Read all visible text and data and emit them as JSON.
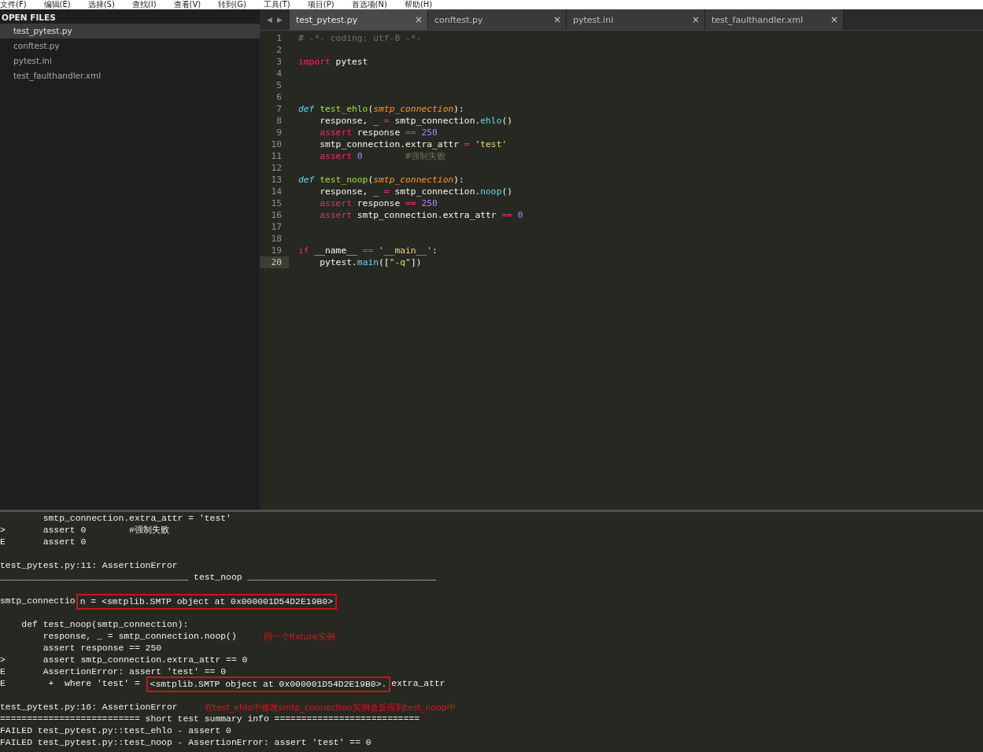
{
  "menu_bar": [
    "文件(F)",
    "编辑(E)",
    "选择(S)",
    "查找(I)",
    "查看(V)",
    "转到(G)",
    "工具(T)",
    "项目(P)",
    "首选项(N)",
    "帮助(H)"
  ],
  "sidebar": {
    "title": "OPEN FILES",
    "items": [
      {
        "label": "test_pytest.py",
        "selected": true
      },
      {
        "label": "conftest.py",
        "selected": false
      },
      {
        "label": "pytest.ini",
        "selected": false
      },
      {
        "label": "test_faulthandler.xml",
        "selected": false
      }
    ]
  },
  "tab_nav": {
    "prev": "◀",
    "next": "▶"
  },
  "tabs": [
    {
      "label": "test_pytest.py",
      "close": "×",
      "selected": true
    },
    {
      "label": "conftest.py",
      "close": "×",
      "selected": false
    },
    {
      "label": "pytest.ini",
      "close": "×",
      "selected": false
    },
    {
      "label": "test_faulthandler.xml",
      "close": "×",
      "selected": false
    }
  ],
  "editor": {
    "lines": [
      {
        "number": "1",
        "current": false,
        "tokens": [
          {
            "kind": "comment",
            "t": "# -*- coding: utf-8 -*-"
          }
        ]
      },
      {
        "number": "2",
        "current": false
      },
      {
        "number": "3",
        "current": false,
        "tokens": [
          {
            "kind": "kw",
            "t": "import"
          },
          {
            "kind": "plain",
            "t": " pytest"
          }
        ]
      },
      {
        "number": "4",
        "current": false
      },
      {
        "number": "5",
        "current": false
      },
      {
        "number": "6",
        "current": false
      },
      {
        "number": "7",
        "current": false,
        "tokens": [
          {
            "kind": "def",
            "t": "def"
          },
          {
            "kind": "fn",
            "t": " test_ehlo"
          },
          {
            "kind": "plain",
            "t": "("
          },
          {
            "kind": "param",
            "t": "smtp_connection"
          },
          {
            "kind": "plain",
            "t": "):"
          }
        ]
      },
      {
        "number": "8",
        "current": false,
        "tokens": [
          {
            "kind": "plain",
            "t": "    response, _ "
          },
          {
            "kind": "kw",
            "t": "="
          },
          {
            "kind": "plain",
            "t": " smtp_connection."
          },
          {
            "kind": "call",
            "t": "ehlo"
          },
          {
            "kind": "plain",
            "t": "()"
          }
        ]
      },
      {
        "number": "9",
        "current": false,
        "tokens": [
          {
            "kind": "kw",
            "t": "    assert"
          },
          {
            "kind": "plain",
            "t": " response "
          },
          {
            "kind": "kw",
            "t": "=="
          },
          {
            "kind": "num",
            "t": " 250"
          }
        ]
      },
      {
        "number": "10",
        "current": false,
        "tokens": [
          {
            "kind": "plain",
            "t": "    smtp_connection.extra_attr "
          },
          {
            "kind": "kw",
            "t": "="
          },
          {
            "kind": "str",
            "t": " 'test'"
          }
        ]
      },
      {
        "number": "11",
        "current": false,
        "tokens": [
          {
            "kind": "kw",
            "t": "    assert"
          },
          {
            "kind": "num",
            "t": " 0"
          },
          {
            "kind": "comment",
            "t": "        #强制失败"
          }
        ]
      },
      {
        "number": "12",
        "current": false
      },
      {
        "number": "13",
        "current": false,
        "tokens": [
          {
            "kind": "def",
            "t": "def"
          },
          {
            "kind": "fn",
            "t": " test_noop"
          },
          {
            "kind": "plain",
            "t": "("
          },
          {
            "kind": "param",
            "t": "smtp_connection"
          },
          {
            "kind": "plain",
            "t": "):"
          }
        ]
      },
      {
        "number": "14",
        "current": false,
        "tokens": [
          {
            "kind": "plain",
            "t": "    response, _ "
          },
          {
            "kind": "kw",
            "t": "="
          },
          {
            "kind": "plain",
            "t": " smtp_connection."
          },
          {
            "kind": "call",
            "t": "noop"
          },
          {
            "kind": "plain",
            "t": "()"
          }
        ]
      },
      {
        "number": "15",
        "current": false,
        "tokens": [
          {
            "kind": "kw",
            "t": "    assert"
          },
          {
            "kind": "plain",
            "t": " response "
          },
          {
            "kind": "kw",
            "t": "=="
          },
          {
            "kind": "num",
            "t": " 250"
          }
        ]
      },
      {
        "number": "16",
        "current": false,
        "tokens": [
          {
            "kind": "kw",
            "t": "    assert"
          },
          {
            "kind": "plain",
            "t": " smtp_connection.extra_attr "
          },
          {
            "kind": "kw",
            "t": "=="
          },
          {
            "kind": "num",
            "t": " 0"
          }
        ]
      },
      {
        "number": "17",
        "current": false
      },
      {
        "number": "18",
        "current": false
      },
      {
        "number": "19",
        "current": false,
        "tokens": [
          {
            "kind": "kw",
            "t": "if"
          },
          {
            "kind": "plain",
            "t": " __name__ "
          },
          {
            "kind": "kw",
            "t": "=="
          },
          {
            "kind": "str",
            "t": " '__main__'"
          },
          {
            "kind": "plain",
            "t": ":"
          }
        ]
      },
      {
        "number": "20",
        "current": true,
        "tokens": [
          {
            "kind": "plain",
            "t": "    pytest."
          },
          {
            "kind": "call",
            "t": "main"
          },
          {
            "kind": "plain",
            "t": "(["
          },
          {
            "kind": "str",
            "t": "\"-q\""
          },
          {
            "kind": "plain",
            "t": "])"
          }
        ]
      }
    ]
  },
  "console": {
    "lines": [
      {
        "kind": "output",
        "segments": [
          {
            "kind": "text",
            "t": "        smtp_connection.extra_attr = 'test'"
          }
        ]
      },
      {
        "kind": "output",
        "segments": [
          {
            "kind": "text",
            "t": ">       assert 0        #强制失败"
          }
        ]
      },
      {
        "kind": "output",
        "segments": [
          {
            "kind": "text",
            "t": "E       assert 0"
          }
        ]
      },
      {
        "kind": "blank"
      },
      {
        "kind": "output",
        "segments": [
          {
            "kind": "text",
            "t": "test_pytest.py:11: AssertionError"
          }
        ]
      },
      {
        "kind": "output",
        "segments": [
          {
            "kind": "text",
            "t": "___________________________________ test_noop ___________________________________"
          }
        ]
      },
      {
        "kind": "blank"
      },
      {
        "kind": "output",
        "segments": [
          {
            "kind": "text",
            "t": "smtp_connectio"
          },
          {
            "kind": "boxed",
            "t": "n = <smtplib.SMTP object at 0x000001D54D2E19B0>"
          }
        ]
      },
      {
        "kind": "blank"
      },
      {
        "kind": "output",
        "segments": [
          {
            "kind": "text",
            "t": "    def test_noop(smtp_connection):"
          }
        ]
      },
      {
        "kind": "output",
        "segments": [
          {
            "kind": "text",
            "t": "        response, _ = smtp_connection.noop()"
          },
          {
            "kind": "note",
            "t": "同一个fixture实例"
          }
        ]
      },
      {
        "kind": "output",
        "segments": [
          {
            "kind": "text",
            "t": "        assert response == 250"
          }
        ]
      },
      {
        "kind": "output",
        "segments": [
          {
            "kind": "text",
            "t": ">       assert smtp_connection.extra_attr == 0"
          }
        ]
      },
      {
        "kind": "output",
        "segments": [
          {
            "kind": "text",
            "t": "E       AssertionError: assert 'test' == 0"
          }
        ]
      },
      {
        "kind": "output",
        "segments": [
          {
            "kind": "text",
            "t": "E        +  where 'test' = "
          },
          {
            "kind": "boxed",
            "t": "<smtplib.SMTP object at 0x000001D54D2E19B0>."
          },
          {
            "kind": "text",
            "t": "extra_attr"
          }
        ]
      },
      {
        "kind": "blank"
      },
      {
        "kind": "output",
        "segments": [
          {
            "kind": "text",
            "t": "test_pytest.py:16: AssertionError"
          },
          {
            "kind": "note",
            "t": "在test_ehlo中修改smtp_connection实例会反应到test_noop中"
          }
        ]
      },
      {
        "kind": "output",
        "segments": [
          {
            "kind": "text",
            "t": "========================== short test summary info ==========================="
          }
        ]
      },
      {
        "kind": "output",
        "segments": [
          {
            "kind": "text",
            "t": "FAILED test_pytest.py::test_ehlo - assert 0"
          }
        ]
      },
      {
        "kind": "output",
        "segments": [
          {
            "kind": "text",
            "t": "FAILED test_pytest.py::test_noop - AssertionError: assert 'test' == 0"
          }
        ]
      }
    ]
  }
}
